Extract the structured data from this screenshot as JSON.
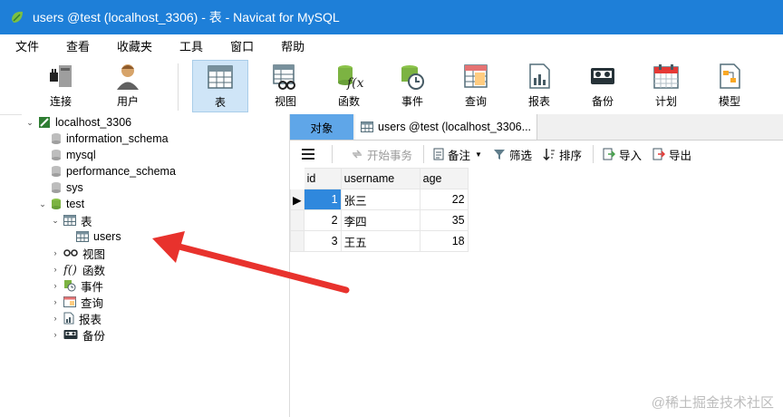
{
  "window": {
    "title": "users @test (localhost_3306) - 表 - Navicat for MySQL"
  },
  "menu": [
    "文件",
    "查看",
    "收藏夹",
    "工具",
    "窗口",
    "帮助"
  ],
  "toolbar": [
    "连接",
    "用户",
    "表",
    "视图",
    "函数",
    "事件",
    "查询",
    "报表",
    "备份",
    "计划",
    "模型"
  ],
  "tree": {
    "connection": "localhost_3306",
    "databases": [
      "information_schema",
      "mysql",
      "performance_schema",
      "sys",
      "test"
    ],
    "groups": [
      "表",
      "视图",
      "函数",
      "事件",
      "查询",
      "报表",
      "备份"
    ],
    "selected_table": "users"
  },
  "tabs": {
    "objects": "对象",
    "editor": "users @test (localhost_3306..."
  },
  "actions": {
    "begin_tx": "开始事务",
    "note": "备注",
    "filter": "筛选",
    "sort": "排序",
    "import": "导入",
    "export": "导出"
  },
  "table": {
    "columns": [
      "id",
      "username",
      "age"
    ],
    "rows": [
      {
        "id": "1",
        "username": "张三",
        "age": "22"
      },
      {
        "id": "2",
        "username": "李四",
        "age": "35"
      },
      {
        "id": "3",
        "username": "王五",
        "age": "18"
      }
    ]
  },
  "watermark": "@稀土掘金技术社区",
  "colors": {
    "titlebar": "#1e7fd8",
    "active_tab": "#5fa6e8",
    "selected_cell": "#2f88dd",
    "arrow": "#e8322d"
  }
}
